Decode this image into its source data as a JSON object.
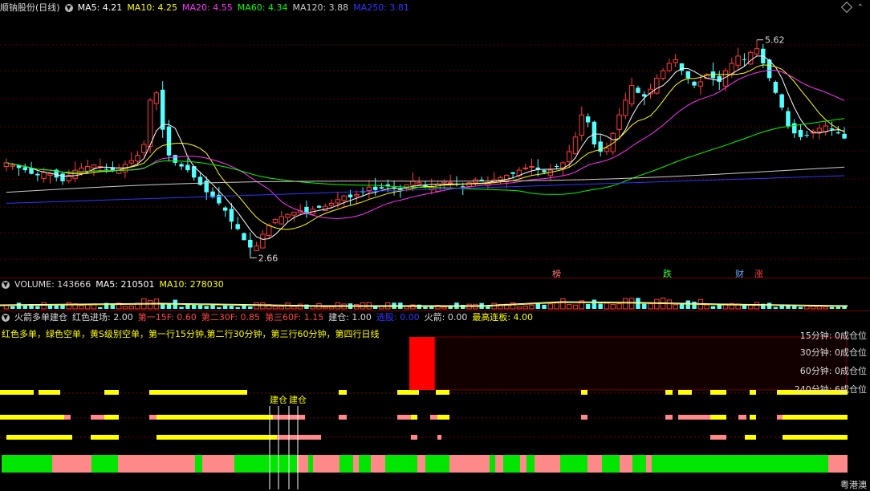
{
  "main_header": {
    "title": "顺钠股份(日线)",
    "ma5": "MA5: 4.21",
    "ma10": "MA10: 4.25",
    "ma20": "MA20: 4.55",
    "ma60": "MA60: 4.34",
    "ma120": "MA120: 3.88",
    "ma250": "MA250: 3.81"
  },
  "main_chart": {
    "high_label": "5.62",
    "low_label": "2.66",
    "events": [
      {
        "text": "榜",
        "color": "#ff7777"
      },
      {
        "text": "跌",
        "color": "#33ff33"
      },
      {
        "text": "财",
        "color": "#66aaff"
      },
      {
        "text": "涨",
        "color": "#ff4444"
      }
    ]
  },
  "volume_header": {
    "title": "VOLUME: 143666",
    "ma5": "MA5: 210501",
    "ma10": "MA10: 278030"
  },
  "indicator_header": {
    "title": "火箭多单建仓",
    "red_entry": "红色进场: 2.00",
    "first_15f": "第一15F: 0.60",
    "second_30f": "第二30F: 0.85",
    "third_60f": "第三60F: 1.15",
    "build": "建仓: 1.00",
    "select": "选股: 0.00",
    "rocket": "火箭: 0.00",
    "max_limit": "最高连板: 4.00"
  },
  "indicator": {
    "description": "红色多单，绿色空单，黄S级别空单，第一行15分钟,第二行30分钟，第三行60分钟，第四行日线",
    "rows": [
      "15分钟: 0成仓位",
      "30分钟: 0成仓位",
      "60分钟: 0成仓位",
      "240分钟: 6成仓位"
    ],
    "marker_text": "建仓"
  },
  "watermark": "粤港澳",
  "colors": {
    "up": "#ff3c3c",
    "down": "#54ffff",
    "ma5": "#ffffff",
    "ma10": "#ffff00",
    "ma20": "#ff33ff",
    "ma60": "#00ff00",
    "ma120": "#cccccc",
    "ma250": "#3333ff"
  },
  "chart_data": {
    "type": "candlestick",
    "title": "顺钠股份(日线)",
    "ylim": [
      2.5,
      5.9
    ],
    "high": 5.62,
    "low": 2.66,
    "ma_last": {
      "MA5": 4.21,
      "MA10": 4.25,
      "MA20": 4.55,
      "MA60": 4.34,
      "MA120": 3.88,
      "MA250": 3.81
    },
    "closes": [
      3.95,
      3.92,
      3.88,
      3.85,
      3.8,
      3.78,
      3.82,
      3.8,
      3.75,
      3.7,
      3.78,
      3.85,
      3.88,
      3.9,
      3.92,
      3.9,
      3.86,
      3.84,
      3.88,
      3.93,
      3.98,
      4.05,
      4.2,
      4.8,
      4.9,
      4.4,
      4.05,
      3.95,
      3.9,
      3.85,
      3.75,
      3.65,
      3.55,
      3.48,
      3.4,
      3.3,
      3.15,
      3.05,
      2.9,
      2.8,
      2.82,
      2.98,
      3.1,
      3.18,
      3.22,
      3.25,
      3.28,
      3.3,
      3.28,
      3.32,
      3.34,
      3.36,
      3.4,
      3.45,
      3.5,
      3.48,
      3.52,
      3.55,
      3.62,
      3.58,
      3.6,
      3.63,
      3.6,
      3.58,
      3.65,
      3.7,
      3.68,
      3.64,
      3.62,
      3.66,
      3.7,
      3.68,
      3.65,
      3.62,
      3.68,
      3.72,
      3.7,
      3.68,
      3.72,
      3.75,
      3.78,
      3.8,
      3.85,
      3.88,
      3.9,
      3.86,
      3.82,
      3.85,
      3.9,
      3.95,
      4.1,
      4.3,
      4.6,
      4.5,
      4.2,
      4.1,
      4.15,
      4.35,
      4.6,
      4.8,
      5.0,
      4.9,
      4.85,
      4.95,
      5.1,
      5.2,
      5.3,
      5.35,
      5.2,
      5.1,
      5.0,
      5.05,
      5.15,
      5.1,
      5.05,
      5.2,
      5.3,
      5.4,
      5.35,
      5.45,
      5.5,
      5.3,
      5.1,
      4.9,
      4.7,
      4.45,
      4.35,
      4.3,
      4.32,
      4.38,
      4.42,
      4.45,
      4.4,
      4.35,
      4.28
    ]
  }
}
